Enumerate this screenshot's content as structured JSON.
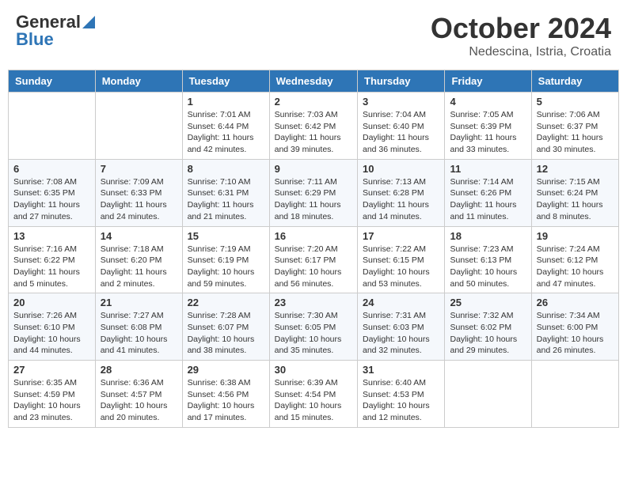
{
  "logo": {
    "general": "General",
    "blue": "Blue"
  },
  "title": "October 2024",
  "location": "Nedescina, Istria, Croatia",
  "days_of_week": [
    "Sunday",
    "Monday",
    "Tuesday",
    "Wednesday",
    "Thursday",
    "Friday",
    "Saturday"
  ],
  "weeks": [
    [
      {
        "day": "",
        "sunrise": "",
        "sunset": "",
        "daylight": ""
      },
      {
        "day": "",
        "sunrise": "",
        "sunset": "",
        "daylight": ""
      },
      {
        "day": "1",
        "sunrise": "Sunrise: 7:01 AM",
        "sunset": "Sunset: 6:44 PM",
        "daylight": "Daylight: 11 hours and 42 minutes."
      },
      {
        "day": "2",
        "sunrise": "Sunrise: 7:03 AM",
        "sunset": "Sunset: 6:42 PM",
        "daylight": "Daylight: 11 hours and 39 minutes."
      },
      {
        "day": "3",
        "sunrise": "Sunrise: 7:04 AM",
        "sunset": "Sunset: 6:40 PM",
        "daylight": "Daylight: 11 hours and 36 minutes."
      },
      {
        "day": "4",
        "sunrise": "Sunrise: 7:05 AM",
        "sunset": "Sunset: 6:39 PM",
        "daylight": "Daylight: 11 hours and 33 minutes."
      },
      {
        "day": "5",
        "sunrise": "Sunrise: 7:06 AM",
        "sunset": "Sunset: 6:37 PM",
        "daylight": "Daylight: 11 hours and 30 minutes."
      }
    ],
    [
      {
        "day": "6",
        "sunrise": "Sunrise: 7:08 AM",
        "sunset": "Sunset: 6:35 PM",
        "daylight": "Daylight: 11 hours and 27 minutes."
      },
      {
        "day": "7",
        "sunrise": "Sunrise: 7:09 AM",
        "sunset": "Sunset: 6:33 PM",
        "daylight": "Daylight: 11 hours and 24 minutes."
      },
      {
        "day": "8",
        "sunrise": "Sunrise: 7:10 AM",
        "sunset": "Sunset: 6:31 PM",
        "daylight": "Daylight: 11 hours and 21 minutes."
      },
      {
        "day": "9",
        "sunrise": "Sunrise: 7:11 AM",
        "sunset": "Sunset: 6:29 PM",
        "daylight": "Daylight: 11 hours and 18 minutes."
      },
      {
        "day": "10",
        "sunrise": "Sunrise: 7:13 AM",
        "sunset": "Sunset: 6:28 PM",
        "daylight": "Daylight: 11 hours and 14 minutes."
      },
      {
        "day": "11",
        "sunrise": "Sunrise: 7:14 AM",
        "sunset": "Sunset: 6:26 PM",
        "daylight": "Daylight: 11 hours and 11 minutes."
      },
      {
        "day": "12",
        "sunrise": "Sunrise: 7:15 AM",
        "sunset": "Sunset: 6:24 PM",
        "daylight": "Daylight: 11 hours and 8 minutes."
      }
    ],
    [
      {
        "day": "13",
        "sunrise": "Sunrise: 7:16 AM",
        "sunset": "Sunset: 6:22 PM",
        "daylight": "Daylight: 11 hours and 5 minutes."
      },
      {
        "day": "14",
        "sunrise": "Sunrise: 7:18 AM",
        "sunset": "Sunset: 6:20 PM",
        "daylight": "Daylight: 11 hours and 2 minutes."
      },
      {
        "day": "15",
        "sunrise": "Sunrise: 7:19 AM",
        "sunset": "Sunset: 6:19 PM",
        "daylight": "Daylight: 10 hours and 59 minutes."
      },
      {
        "day": "16",
        "sunrise": "Sunrise: 7:20 AM",
        "sunset": "Sunset: 6:17 PM",
        "daylight": "Daylight: 10 hours and 56 minutes."
      },
      {
        "day": "17",
        "sunrise": "Sunrise: 7:22 AM",
        "sunset": "Sunset: 6:15 PM",
        "daylight": "Daylight: 10 hours and 53 minutes."
      },
      {
        "day": "18",
        "sunrise": "Sunrise: 7:23 AM",
        "sunset": "Sunset: 6:13 PM",
        "daylight": "Daylight: 10 hours and 50 minutes."
      },
      {
        "day": "19",
        "sunrise": "Sunrise: 7:24 AM",
        "sunset": "Sunset: 6:12 PM",
        "daylight": "Daylight: 10 hours and 47 minutes."
      }
    ],
    [
      {
        "day": "20",
        "sunrise": "Sunrise: 7:26 AM",
        "sunset": "Sunset: 6:10 PM",
        "daylight": "Daylight: 10 hours and 44 minutes."
      },
      {
        "day": "21",
        "sunrise": "Sunrise: 7:27 AM",
        "sunset": "Sunset: 6:08 PM",
        "daylight": "Daylight: 10 hours and 41 minutes."
      },
      {
        "day": "22",
        "sunrise": "Sunrise: 7:28 AM",
        "sunset": "Sunset: 6:07 PM",
        "daylight": "Daylight: 10 hours and 38 minutes."
      },
      {
        "day": "23",
        "sunrise": "Sunrise: 7:30 AM",
        "sunset": "Sunset: 6:05 PM",
        "daylight": "Daylight: 10 hours and 35 minutes."
      },
      {
        "day": "24",
        "sunrise": "Sunrise: 7:31 AM",
        "sunset": "Sunset: 6:03 PM",
        "daylight": "Daylight: 10 hours and 32 minutes."
      },
      {
        "day": "25",
        "sunrise": "Sunrise: 7:32 AM",
        "sunset": "Sunset: 6:02 PM",
        "daylight": "Daylight: 10 hours and 29 minutes."
      },
      {
        "day": "26",
        "sunrise": "Sunrise: 7:34 AM",
        "sunset": "Sunset: 6:00 PM",
        "daylight": "Daylight: 10 hours and 26 minutes."
      }
    ],
    [
      {
        "day": "27",
        "sunrise": "Sunrise: 6:35 AM",
        "sunset": "Sunset: 4:59 PM",
        "daylight": "Daylight: 10 hours and 23 minutes."
      },
      {
        "day": "28",
        "sunrise": "Sunrise: 6:36 AM",
        "sunset": "Sunset: 4:57 PM",
        "daylight": "Daylight: 10 hours and 20 minutes."
      },
      {
        "day": "29",
        "sunrise": "Sunrise: 6:38 AM",
        "sunset": "Sunset: 4:56 PM",
        "daylight": "Daylight: 10 hours and 17 minutes."
      },
      {
        "day": "30",
        "sunrise": "Sunrise: 6:39 AM",
        "sunset": "Sunset: 4:54 PM",
        "daylight": "Daylight: 10 hours and 15 minutes."
      },
      {
        "day": "31",
        "sunrise": "Sunrise: 6:40 AM",
        "sunset": "Sunset: 4:53 PM",
        "daylight": "Daylight: 10 hours and 12 minutes."
      },
      {
        "day": "",
        "sunrise": "",
        "sunset": "",
        "daylight": ""
      },
      {
        "day": "",
        "sunrise": "",
        "sunset": "",
        "daylight": ""
      }
    ]
  ]
}
